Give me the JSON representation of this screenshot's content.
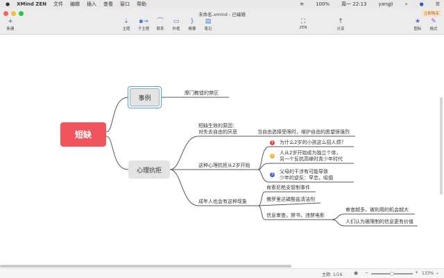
{
  "menubar": {
    "app": "XMind ZEN",
    "items": [
      "文件",
      "编辑",
      "插入",
      "查看",
      "窗口",
      "帮助"
    ],
    "battery": "100%",
    "clock": "周一 22:13",
    "user": "yangji"
  },
  "window": {
    "title": "未命名.xmind - 已编辑",
    "buy_label": "立即购买"
  },
  "toolbar": {
    "new": "新建",
    "topic": "主题",
    "subtopic": "子主题",
    "relation": "联系",
    "boundary": "外框",
    "summary": "概要",
    "note": "笔记",
    "zen": "ZEN",
    "share": "分享",
    "icon": "图标",
    "format": "格式"
  },
  "map": {
    "root": "短缺",
    "example": {
      "label": "事例",
      "child": "摩门教徒的禁区"
    },
    "resist": {
      "label": "心理抗拒",
      "cause": {
        "line1": "短缺生效的原因：",
        "line2": "对失去自由的厌恶",
        "child": "当自由选择受限时，维护自由的愿望很强烈"
      },
      "age2": {
        "label": "这种心理抗拒从2岁开始",
        "items": [
          {
            "n": "1",
            "color": "#e04545",
            "line1": "为什么2岁的小孩这么招人烦？",
            "line2": ""
          },
          {
            "n": "2",
            "color": "#f0b429",
            "line1": "人从2岁开始成为独立个体，",
            "line2": "另一个反抗高峰时青少年时代"
          },
          {
            "n": "3",
            "color": "#4a5fd8",
            "line1": "父母的干涉有可能导致",
            "line2": "少年的逆反：早恋，吸烟"
          }
        ]
      },
      "adult": {
        "label": "成年人也会有这种现象",
        "items": [
          "肯索尼枪支管制事件",
          "佛罗里达磷酸盐清洁剂",
          "信息审查，禁书，违禁电影"
        ],
        "censor_children": [
          "审查越多，被利用的机会越大",
          "人们认为被限制的信息更有价值"
        ]
      }
    }
  },
  "status": {
    "topic_count": "主题: 1/16",
    "zoom": "133%"
  },
  "colors": {
    "root": "#f0555d",
    "selected": "#3ea3e8"
  }
}
